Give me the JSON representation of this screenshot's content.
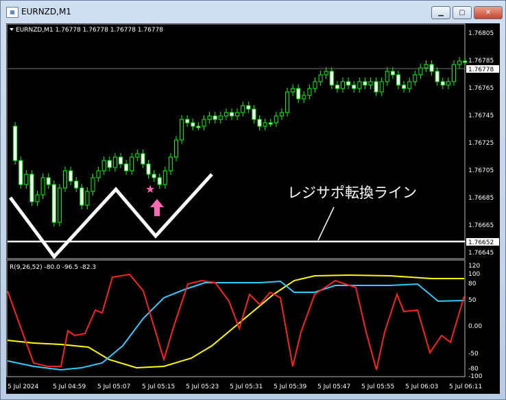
{
  "window": {
    "title": "EURNZD,M1",
    "minimize_label": "▁",
    "maximize_label": "▢",
    "close_label": "✕"
  },
  "main_chart": {
    "header": "EURNZD,M1  1.76778 1.76778 1.76778 1.76778",
    "price_labels": [
      "1.76805",
      "1.76785",
      "1.76765",
      "1.76745",
      "1.76725",
      "1.76705",
      "1.76685",
      "1.76665",
      "1.76645"
    ],
    "current_price": "1.76778",
    "line_price": "1.76652",
    "annotation": "レジサポ転換ライン",
    "colors": {
      "bull": "#00ff00",
      "bear": "#ffffff",
      "star": "#ff69b4",
      "arrow": "#ff69b4"
    }
  },
  "indicator": {
    "header": "R(9,26,52) -80.0 -96.5 -82.3",
    "scale_labels": [
      "120",
      "100",
      "80",
      "50",
      "0.00",
      "-50",
      "-80",
      "-100"
    ],
    "colors": {
      "r1": "#ff0000",
      "r2": "#33ccff",
      "r3": "#ffff00"
    }
  },
  "time_labels": [
    "5 Jul 2024",
    "5 Jul 04:59",
    "5 Jul 05:07",
    "5 Jul 05:15",
    "5 Jul 05:23",
    "5 Jul 05:31",
    "5 Jul 05:39",
    "5 Jul 05:47",
    "5 Jul 05:55",
    "5 Jul 06:03",
    "5 Jul 06:11"
  ]
}
